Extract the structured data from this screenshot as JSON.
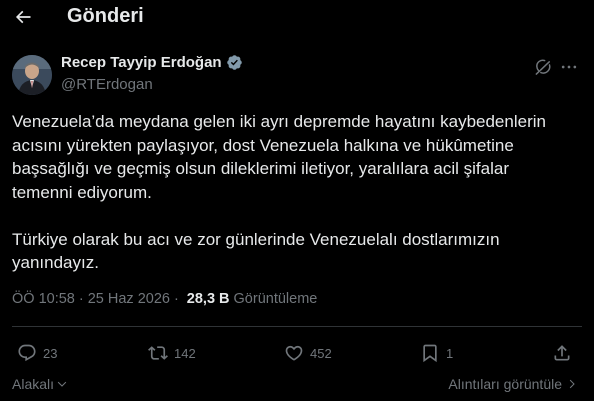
{
  "header": {
    "title": "Gönderi",
    "back_icon": "arrow-left-icon"
  },
  "author": {
    "display_name": "Recep Tayyip Erdoğan",
    "handle": "@RTErdogan",
    "verified": true,
    "verified_color": "#829aab"
  },
  "tweet": {
    "paragraphs": [
      "Venezuela’da meydana gelen iki ayrı depremde hayatını kaybedenlerin\nacısını yürekten paylaşıyor, dost Venezuela halkına ve hükûmetine\nbaşsağlığı ve geçmiş olsun dileklerimi iletiyor, yaralılara acil şifalar\ntemenni ediyorum.",
      "Türkiye olarak bu acı ve zor günlerinde Venezuelalı dostlarımızın\nyanındayız."
    ]
  },
  "meta": {
    "time": "ÖÖ 10:58",
    "date": "25 Haz 2026",
    "views": "28,3 B",
    "views_label": "Görüntüleme"
  },
  "actions": {
    "replies": "23",
    "reposts": "142",
    "likes": "452",
    "bookmarks": "1"
  },
  "footer": {
    "related_label": "Alakalı",
    "quotes_label": "Alıntıları görüntüle"
  },
  "colors": {
    "background": "#000000",
    "text": "#e7e9ea",
    "muted": "#71767b",
    "divider": "#2f3336"
  }
}
